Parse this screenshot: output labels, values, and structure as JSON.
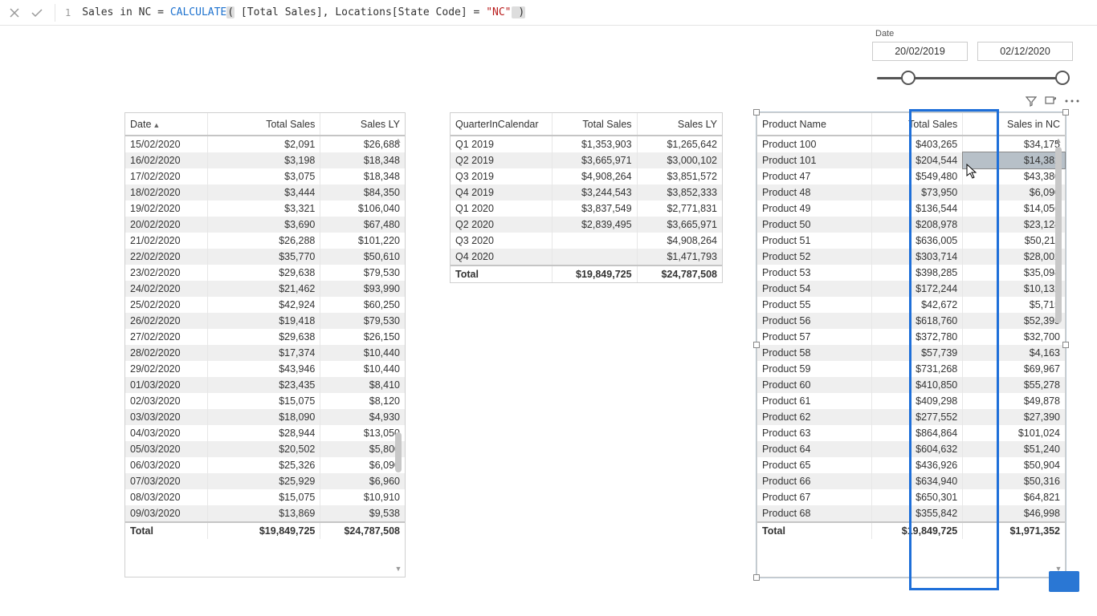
{
  "formula": {
    "line_no": "1",
    "measure_name": "Sales in NC",
    "equals": " = ",
    "func": "CALCULATE",
    "open_paren": "(",
    "arg1": " [Total Sales]",
    "comma": ", ",
    "arg2a": "Locations[State Code]",
    "arg2b": " = ",
    "str": "\"NC\"",
    "close_paren": " )"
  },
  "date_slicer": {
    "label": "Date",
    "from": "20/02/2019",
    "to": "02/12/2020"
  },
  "tables": {
    "date": {
      "header": {
        "c1": "Date",
        "c2": "Total Sales",
        "c3": "Sales LY"
      },
      "rows": [
        {
          "c1": "15/02/2020",
          "c2": "$2,091",
          "c3": "$26,688"
        },
        {
          "c1": "16/02/2020",
          "c2": "$3,198",
          "c3": "$18,348"
        },
        {
          "c1": "17/02/2020",
          "c2": "$3,075",
          "c3": "$18,348"
        },
        {
          "c1": "18/02/2020",
          "c2": "$3,444",
          "c3": "$84,350"
        },
        {
          "c1": "19/02/2020",
          "c2": "$3,321",
          "c3": "$106,040"
        },
        {
          "c1": "20/02/2020",
          "c2": "$3,690",
          "c3": "$67,480"
        },
        {
          "c1": "21/02/2020",
          "c2": "$26,288",
          "c3": "$101,220"
        },
        {
          "c1": "22/02/2020",
          "c2": "$35,770",
          "c3": "$50,610"
        },
        {
          "c1": "23/02/2020",
          "c2": "$29,638",
          "c3": "$79,530"
        },
        {
          "c1": "24/02/2020",
          "c2": "$21,462",
          "c3": "$93,990"
        },
        {
          "c1": "25/02/2020",
          "c2": "$42,924",
          "c3": "$60,250"
        },
        {
          "c1": "26/02/2020",
          "c2": "$19,418",
          "c3": "$79,530"
        },
        {
          "c1": "27/02/2020",
          "c2": "$29,638",
          "c3": "$26,150"
        },
        {
          "c1": "28/02/2020",
          "c2": "$17,374",
          "c3": "$10,440"
        },
        {
          "c1": "29/02/2020",
          "c2": "$43,946",
          "c3": "$10,440"
        },
        {
          "c1": "01/03/2020",
          "c2": "$23,435",
          "c3": "$8,410"
        },
        {
          "c1": "02/03/2020",
          "c2": "$15,075",
          "c3": "$8,120"
        },
        {
          "c1": "03/03/2020",
          "c2": "$18,090",
          "c3": "$4,930"
        },
        {
          "c1": "04/03/2020",
          "c2": "$28,944",
          "c3": "$13,050"
        },
        {
          "c1": "05/03/2020",
          "c2": "$20,502",
          "c3": "$5,800"
        },
        {
          "c1": "06/03/2020",
          "c2": "$25,326",
          "c3": "$6,090"
        },
        {
          "c1": "07/03/2020",
          "c2": "$25,929",
          "c3": "$6,960"
        },
        {
          "c1": "08/03/2020",
          "c2": "$15,075",
          "c3": "$10,910"
        },
        {
          "c1": "09/03/2020",
          "c2": "$13,869",
          "c3": "$9,538"
        }
      ],
      "total": {
        "c1": "Total",
        "c2": "$19,849,725",
        "c3": "$24,787,508"
      }
    },
    "quarter": {
      "header": {
        "c1": "QuarterInCalendar",
        "c2": "Total Sales",
        "c3": "Sales LY"
      },
      "rows": [
        {
          "c1": "Q1 2019",
          "c2": "$1,353,903",
          "c3": "$1,265,642"
        },
        {
          "c1": "Q2 2019",
          "c2": "$3,665,971",
          "c3": "$3,000,102"
        },
        {
          "c1": "Q3 2019",
          "c2": "$4,908,264",
          "c3": "$3,851,572"
        },
        {
          "c1": "Q4 2019",
          "c2": "$3,244,543",
          "c3": "$3,852,333"
        },
        {
          "c1": "Q1 2020",
          "c2": "$3,837,549",
          "c3": "$2,771,831"
        },
        {
          "c1": "Q2 2020",
          "c2": "$2,839,495",
          "c3": "$3,665,971"
        },
        {
          "c1": "Q3 2020",
          "c2": "",
          "c3": "$4,908,264"
        },
        {
          "c1": "Q4 2020",
          "c2": "",
          "c3": "$1,471,793"
        }
      ],
      "total": {
        "c1": "Total",
        "c2": "$19,849,725",
        "c3": "$24,787,508"
      }
    },
    "product": {
      "header": {
        "c1": "Product Name",
        "c2": "Total Sales",
        "c3": "Sales in NC"
      },
      "rows": [
        {
          "c1": "Product 100",
          "c2": "$403,265",
          "c3": "$34,175"
        },
        {
          "c1": "Product 101",
          "c2": "$204,544",
          "c3": "$14,382"
        },
        {
          "c1": "Product 47",
          "c2": "$549,480",
          "c3": "$43,380"
        },
        {
          "c1": "Product 48",
          "c2": "$73,950",
          "c3": "$6,090"
        },
        {
          "c1": "Product 49",
          "c2": "$136,544",
          "c3": "$14,056"
        },
        {
          "c1": "Product 50",
          "c2": "$208,978",
          "c3": "$23,128"
        },
        {
          "c1": "Product 51",
          "c2": "$636,005",
          "c3": "$50,211"
        },
        {
          "c1": "Product 52",
          "c2": "$303,714",
          "c3": "$28,002"
        },
        {
          "c1": "Product 53",
          "c2": "$398,285",
          "c3": "$35,098"
        },
        {
          "c1": "Product 54",
          "c2": "$172,244",
          "c3": "$10,132"
        },
        {
          "c1": "Product 55",
          "c2": "$42,672",
          "c3": "$5,715"
        },
        {
          "c1": "Product 56",
          "c2": "$618,760",
          "c3": "$52,395"
        },
        {
          "c1": "Product 57",
          "c2": "$372,780",
          "c3": "$32,700"
        },
        {
          "c1": "Product 58",
          "c2": "$57,739",
          "c3": "$4,163"
        },
        {
          "c1": "Product 59",
          "c2": "$731,268",
          "c3": "$69,967"
        },
        {
          "c1": "Product 60",
          "c2": "$410,850",
          "c3": "$55,278"
        },
        {
          "c1": "Product 61",
          "c2": "$409,298",
          "c3": "$49,878"
        },
        {
          "c1": "Product 62",
          "c2": "$277,552",
          "c3": "$27,390"
        },
        {
          "c1": "Product 63",
          "c2": "$864,864",
          "c3": "$101,024"
        },
        {
          "c1": "Product 64",
          "c2": "$604,632",
          "c3": "$51,240"
        },
        {
          "c1": "Product 65",
          "c2": "$436,926",
          "c3": "$50,904"
        },
        {
          "c1": "Product 66",
          "c2": "$634,940",
          "c3": "$50,316"
        },
        {
          "c1": "Product 67",
          "c2": "$650,301",
          "c3": "$64,821"
        },
        {
          "c1": "Product 68",
          "c2": "$355,842",
          "c3": "$46,998"
        }
      ],
      "total": {
        "c1": "Total",
        "c2": "$19,849,725",
        "c3": "$1,971,352"
      }
    }
  }
}
